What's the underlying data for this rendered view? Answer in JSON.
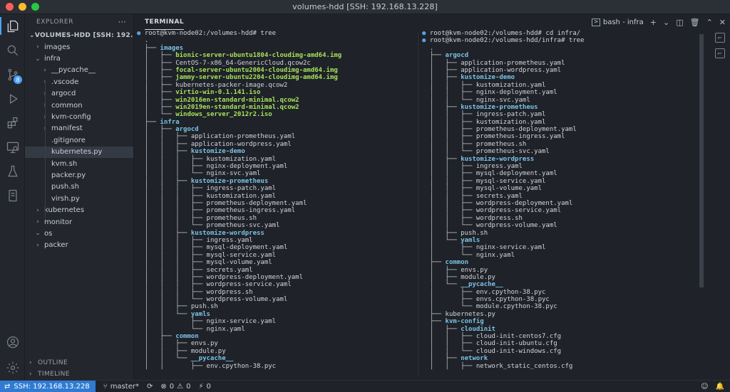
{
  "window": {
    "title": "volumes-hdd [SSH: 192.168.13.228]"
  },
  "sidebar": {
    "header": "EXPLORER",
    "more": "···",
    "root": "VOLUMES-HDD [SSH: 192.168.13...",
    "items": [
      {
        "label": "images",
        "kind": "folder",
        "open": false,
        "depth": 0
      },
      {
        "label": "infra",
        "kind": "folder",
        "open": true,
        "depth": 0
      },
      {
        "label": "__pycache__",
        "kind": "folder",
        "open": false,
        "depth": 1
      },
      {
        "label": ".vscode",
        "kind": "folder",
        "open": false,
        "depth": 1
      },
      {
        "label": "argocd",
        "kind": "folder",
        "open": false,
        "depth": 1
      },
      {
        "label": "common",
        "kind": "folder",
        "open": false,
        "depth": 1
      },
      {
        "label": "kvm-config",
        "kind": "folder",
        "open": false,
        "depth": 1
      },
      {
        "label": "manifest",
        "kind": "folder",
        "open": false,
        "depth": 1
      },
      {
        "label": ".gitignore",
        "kind": "file",
        "depth": 1
      },
      {
        "label": "kubernetes.py",
        "kind": "file",
        "depth": 1,
        "selected": true
      },
      {
        "label": "kvm.sh",
        "kind": "file",
        "depth": 1
      },
      {
        "label": "packer.py",
        "kind": "file",
        "depth": 1
      },
      {
        "label": "push.sh",
        "kind": "file",
        "depth": 1
      },
      {
        "label": "virsh.py",
        "kind": "file",
        "depth": 1
      },
      {
        "label": "kubernetes",
        "kind": "folder",
        "open": false,
        "depth": 0
      },
      {
        "label": "monitor",
        "kind": "folder",
        "open": false,
        "depth": 0
      },
      {
        "label": "os",
        "kind": "folder",
        "open": true,
        "depth": 0
      },
      {
        "label": "packer",
        "kind": "folder",
        "open": false,
        "depth": 0
      }
    ],
    "outline": "OUTLINE",
    "timeline": "TIMELINE"
  },
  "panel": {
    "tab": "TERMINAL",
    "terminal_name": "bash - infra",
    "icons": [
      "add-icon",
      "chevron-down-icon",
      "split-icon",
      "trash-icon",
      "maximize-icon",
      "close-icon"
    ]
  },
  "terminal_left": {
    "lines": [
      {
        "t": "prompt",
        "text": "root@kvm-node02:/volumes-hdd# tree"
      },
      {
        "t": "txt",
        "text": "."
      },
      {
        "t": "dir",
        "p": "├── ",
        "text": "images"
      },
      {
        "t": "exe",
        "p": "│   ├── ",
        "text": "bionic-server-ubuntu1804-cloudimg-amd64.img"
      },
      {
        "t": "txt",
        "p": "│   ├── ",
        "text": "CentOS-7-x86_64-GenericCloud.qcow2c"
      },
      {
        "t": "exe",
        "p": "│   ├── ",
        "text": "focal-server-ubuntu2004-cloudimg-amd64.img"
      },
      {
        "t": "exe",
        "p": "│   ├── ",
        "text": "jammy-server-ubuntu2204-cloudimg-amd64.img"
      },
      {
        "t": "txt",
        "p": "│   ├── ",
        "text": "kubernetes-packer-image.qcow2"
      },
      {
        "t": "exe",
        "p": "│   ├── ",
        "text": "virtio-win-0.1.141.iso"
      },
      {
        "t": "exe",
        "p": "│   ├── ",
        "text": "win2016en-standard-minimal.qcow2"
      },
      {
        "t": "exe",
        "p": "│   ├── ",
        "text": "win2019en-standard-minimal.qcow2"
      },
      {
        "t": "exe",
        "p": "│   └── ",
        "text": "windows_server_2012r2.iso"
      },
      {
        "t": "dir",
        "p": "├── ",
        "text": "infra"
      },
      {
        "t": "dir",
        "p": "│   ├── ",
        "text": "argocd"
      },
      {
        "t": "txt",
        "p": "│   │   ├── ",
        "text": "application-prometheus.yaml"
      },
      {
        "t": "txt",
        "p": "│   │   ├── ",
        "text": "application-wordpress.yaml"
      },
      {
        "t": "dir",
        "p": "│   │   ├── ",
        "text": "kustomize-demo"
      },
      {
        "t": "txt",
        "p": "│   │   │   ├── ",
        "text": "kustomization.yaml"
      },
      {
        "t": "txt",
        "p": "│   │   │   ├── ",
        "text": "nginx-deployment.yaml"
      },
      {
        "t": "txt",
        "p": "│   │   │   └── ",
        "text": "nginx-svc.yaml"
      },
      {
        "t": "dir",
        "p": "│   │   ├── ",
        "text": "kustomize-prometheus"
      },
      {
        "t": "txt",
        "p": "│   │   │   ├── ",
        "text": "ingress-patch.yaml"
      },
      {
        "t": "txt",
        "p": "│   │   │   ├── ",
        "text": "kustomization.yaml"
      },
      {
        "t": "txt",
        "p": "│   │   │   ├── ",
        "text": "prometheus-deployment.yaml"
      },
      {
        "t": "txt",
        "p": "│   │   │   ├── ",
        "text": "prometheus-ingress.yaml"
      },
      {
        "t": "txt",
        "p": "│   │   │   ├── ",
        "text": "prometheus.sh"
      },
      {
        "t": "txt",
        "p": "│   │   │   └── ",
        "text": "prometheus-svc.yaml"
      },
      {
        "t": "dir",
        "p": "│   │   ├── ",
        "text": "kustomize-wordpress"
      },
      {
        "t": "txt",
        "p": "│   │   │   ├── ",
        "text": "ingress.yaml"
      },
      {
        "t": "txt",
        "p": "│   │   │   ├── ",
        "text": "mysql-deployment.yaml"
      },
      {
        "t": "txt",
        "p": "│   │   │   ├── ",
        "text": "mysql-service.yaml"
      },
      {
        "t": "txt",
        "p": "│   │   │   ├── ",
        "text": "mysql-volume.yaml"
      },
      {
        "t": "txt",
        "p": "│   │   │   ├── ",
        "text": "secrets.yaml"
      },
      {
        "t": "txt",
        "p": "│   │   │   ├── ",
        "text": "wordpress-deployment.yaml"
      },
      {
        "t": "txt",
        "p": "│   │   │   ├── ",
        "text": "wordpress-service.yaml"
      },
      {
        "t": "txt",
        "p": "│   │   │   ├── ",
        "text": "wordpress.sh"
      },
      {
        "t": "txt",
        "p": "│   │   │   └── ",
        "text": "wordpress-volume.yaml"
      },
      {
        "t": "txt",
        "p": "│   │   ├── ",
        "text": "push.sh"
      },
      {
        "t": "dir",
        "p": "│   │   └── ",
        "text": "yamls"
      },
      {
        "t": "txt",
        "p": "│   │       ├── ",
        "text": "nginx-service.yaml"
      },
      {
        "t": "txt",
        "p": "│   │       └── ",
        "text": "nginx.yaml"
      },
      {
        "t": "dir",
        "p": "│   ├── ",
        "text": "common"
      },
      {
        "t": "txt",
        "p": "│   │   ├── ",
        "text": "envs.py"
      },
      {
        "t": "txt",
        "p": "│   │   ├── ",
        "text": "module.py"
      },
      {
        "t": "dir",
        "p": "│   │   └── ",
        "text": "__pycache__"
      },
      {
        "t": "txt",
        "p": "│   │       ├── ",
        "text": "env.cpython-38.pyc"
      }
    ]
  },
  "terminal_right": {
    "lines": [
      {
        "t": "prompt",
        "text": "root@kvm-node02:/volumes-hdd# cd infra/"
      },
      {
        "t": "prompt",
        "text": "root@kvm-node02:/volumes-hdd/infra# tree"
      },
      {
        "t": "txt",
        "text": "."
      },
      {
        "t": "dir",
        "p": "├── ",
        "text": "argocd"
      },
      {
        "t": "txt",
        "p": "│   ├── ",
        "text": "application-prometheus.yaml"
      },
      {
        "t": "txt",
        "p": "│   ├── ",
        "text": "application-wordpress.yaml"
      },
      {
        "t": "dir",
        "p": "│   ├── ",
        "text": "kustomize-demo"
      },
      {
        "t": "txt",
        "p": "│   │   ├── ",
        "text": "kustomization.yaml"
      },
      {
        "t": "txt",
        "p": "│   │   ├── ",
        "text": "nginx-deployment.yaml"
      },
      {
        "t": "txt",
        "p": "│   │   └── ",
        "text": "nginx-svc.yaml"
      },
      {
        "t": "dir",
        "p": "│   ├── ",
        "text": "kustomize-prometheus"
      },
      {
        "t": "txt",
        "p": "│   │   ├── ",
        "text": "ingress-patch.yaml"
      },
      {
        "t": "txt",
        "p": "│   │   ├── ",
        "text": "kustomization.yaml"
      },
      {
        "t": "txt",
        "p": "│   │   ├── ",
        "text": "prometheus-deployment.yaml"
      },
      {
        "t": "txt",
        "p": "│   │   ├── ",
        "text": "prometheus-ingress.yaml"
      },
      {
        "t": "txt",
        "p": "│   │   ├── ",
        "text": "prometheus.sh"
      },
      {
        "t": "txt",
        "p": "│   │   └── ",
        "text": "prometheus-svc.yaml"
      },
      {
        "t": "dir",
        "p": "│   ├── ",
        "text": "kustomize-wordpress"
      },
      {
        "t": "txt",
        "p": "│   │   ├── ",
        "text": "ingress.yaml"
      },
      {
        "t": "txt",
        "p": "│   │   ├── ",
        "text": "mysql-deployment.yaml"
      },
      {
        "t": "txt",
        "p": "│   │   ├── ",
        "text": "mysql-service.yaml"
      },
      {
        "t": "txt",
        "p": "│   │   ├── ",
        "text": "mysql-volume.yaml"
      },
      {
        "t": "txt",
        "p": "│   │   ├── ",
        "text": "secrets.yaml"
      },
      {
        "t": "txt",
        "p": "│   │   ├── ",
        "text": "wordpress-deployment.yaml"
      },
      {
        "t": "txt",
        "p": "│   │   ├── ",
        "text": "wordpress-service.yaml"
      },
      {
        "t": "txt",
        "p": "│   │   ├── ",
        "text": "wordpress.sh"
      },
      {
        "t": "txt",
        "p": "│   │   └── ",
        "text": "wordpress-volume.yaml"
      },
      {
        "t": "txt",
        "p": "│   ├── ",
        "text": "push.sh"
      },
      {
        "t": "dir",
        "p": "│   └── ",
        "text": "yamls"
      },
      {
        "t": "txt",
        "p": "│       ├── ",
        "text": "nginx-service.yaml"
      },
      {
        "t": "txt",
        "p": "│       └── ",
        "text": "nginx.yaml"
      },
      {
        "t": "dir",
        "p": "├── ",
        "text": "common"
      },
      {
        "t": "txt",
        "p": "│   ├── ",
        "text": "envs.py"
      },
      {
        "t": "txt",
        "p": "│   ├── ",
        "text": "module.py"
      },
      {
        "t": "dir",
        "p": "│   └── ",
        "text": "__pycache__"
      },
      {
        "t": "txt",
        "p": "│       ├── ",
        "text": "env.cpython-38.pyc"
      },
      {
        "t": "txt",
        "p": "│       ├── ",
        "text": "envs.cpython-38.pyc"
      },
      {
        "t": "txt",
        "p": "│       └── ",
        "text": "module.cpython-38.pyc"
      },
      {
        "t": "txt",
        "p": "├── ",
        "text": "kubernetes.py"
      },
      {
        "t": "dir",
        "p": "├── ",
        "text": "kvm-config"
      },
      {
        "t": "dir",
        "p": "│   ├── ",
        "text": "cloudinit"
      },
      {
        "t": "txt",
        "p": "│   │   ├── ",
        "text": "cloud-init-centos7.cfg"
      },
      {
        "t": "txt",
        "p": "│   │   ├── ",
        "text": "cloud-init-ubuntu.cfg"
      },
      {
        "t": "txt",
        "p": "│   │   └── ",
        "text": "cloud-init-windows.cfg"
      },
      {
        "t": "dir",
        "p": "│   ├── ",
        "text": "network"
      },
      {
        "t": "txt",
        "p": "│   │   ├── ",
        "text": "network_static_centos.cfg"
      }
    ]
  },
  "statusbar": {
    "remote": "SSH: 192.168.13.228",
    "branch": "master*",
    "errors": "0",
    "warnings": "0",
    "ports": "0"
  },
  "colors": {
    "accent": "#2f7bd3",
    "dir": "#7ac3e6",
    "exe": "#a6e05a"
  }
}
